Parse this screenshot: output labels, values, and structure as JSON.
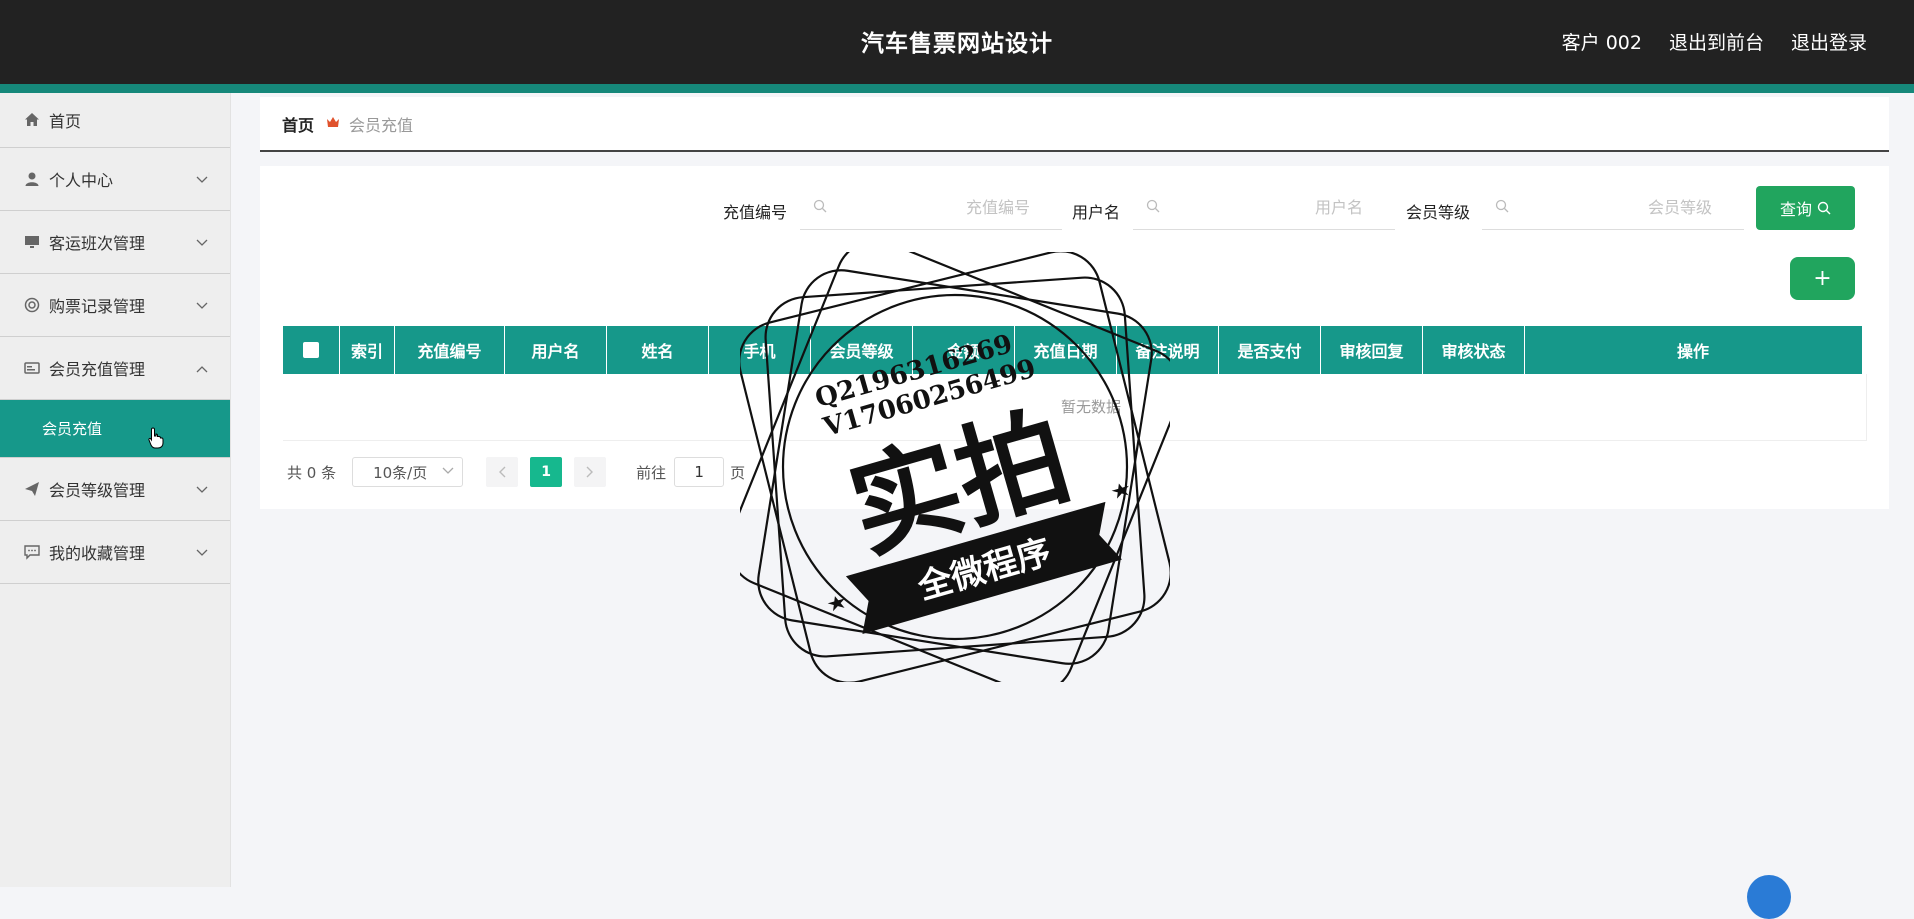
{
  "header": {
    "title": "汽车售票网站设计",
    "user": "客户 002",
    "back_to_front": "退出到前台",
    "logout": "退出登录"
  },
  "sidebar": {
    "items": [
      {
        "label": "首页",
        "icon": "home-icon"
      },
      {
        "label": "个人中心",
        "icon": "user-icon"
      },
      {
        "label": "客运班次管理",
        "icon": "monitor-icon"
      },
      {
        "label": "购票记录管理",
        "icon": "lifebuoy-icon"
      },
      {
        "label": "会员充值管理",
        "icon": "card-icon",
        "expanded": true
      },
      {
        "label": "会员等级管理",
        "icon": "paper-plane-icon"
      },
      {
        "label": "我的收藏管理",
        "icon": "chat-icon"
      }
    ],
    "active_sub": "会员充值"
  },
  "breadcrumb": {
    "home": "首页",
    "current": "会员充值"
  },
  "search": {
    "field1_label": "充值编号",
    "field1_placeholder": "充值编号",
    "field2_label": "用户名",
    "field2_placeholder": "用户名",
    "field3_label": "会员等级",
    "field3_placeholder": "会员等级",
    "query_label": "查询"
  },
  "add_button": "+",
  "table": {
    "columns": [
      "索引",
      "充值编号",
      "用户名",
      "姓名",
      "手机",
      "会员等级",
      "金额",
      "充值日期",
      "备注说明",
      "是否支付",
      "审核回复",
      "审核状态",
      "操作"
    ],
    "empty_text": "暂无数据"
  },
  "pagination": {
    "total": "共 0 条",
    "page_size": "10条/页",
    "current": "1",
    "goto_label": "前往",
    "goto_value": "1",
    "page_suffix": "页"
  },
  "watermark": {
    "line1": "Q2196316269",
    "line2": "V17060256499",
    "main": "实拍",
    "ribbon": "全微程序"
  },
  "colors": {
    "header_bg": "#222222",
    "accent": "#16988a",
    "button_green": "#21a55e",
    "page_current": "#16b88e"
  }
}
